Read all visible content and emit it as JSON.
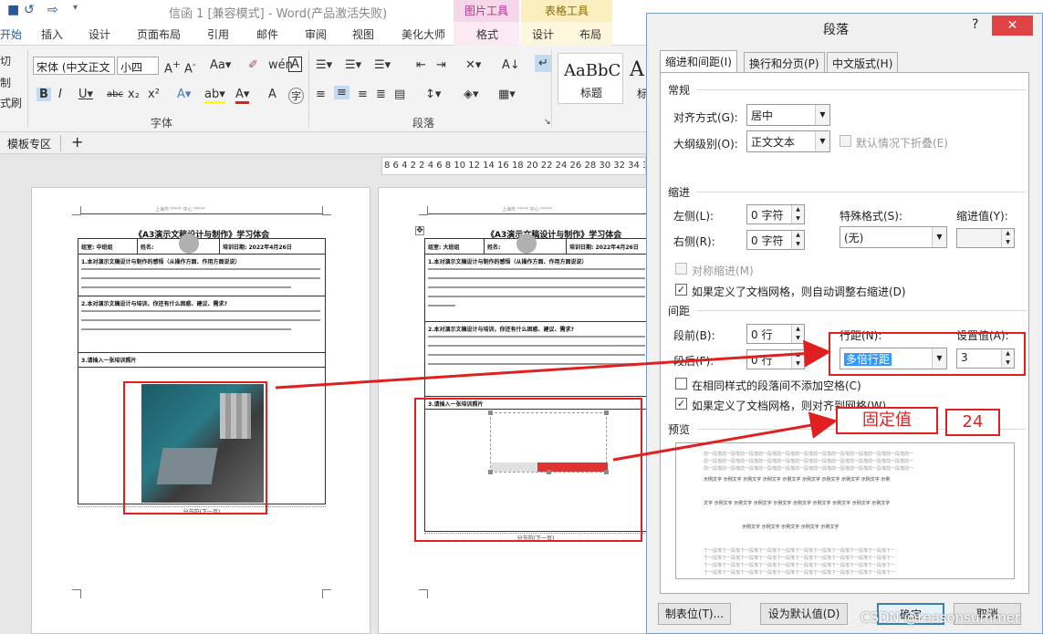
{
  "window": {
    "title": "信函 1 [兼容模式] - Word(产品激活失败)",
    "context_tab_picture": "图片工具",
    "context_tab_table": "表格工具"
  },
  "ribbon_tabs": [
    "开始",
    "插入",
    "设计",
    "页面布局",
    "引用",
    "邮件",
    "审阅",
    "视图",
    "美化大师",
    "格式",
    "设计",
    "布局"
  ],
  "ribbon": {
    "clipboard_cut": "切",
    "clipboard_copy": "制",
    "clipboard_format": "式刷",
    "font_name": "宋体 (中文正文",
    "font_size": "小四",
    "font_group_label": "字体",
    "paragraph_group_label": "段落",
    "style_preview": "AaBbC",
    "style_name": "标题",
    "style_preview2": "A",
    "style_name2": "标"
  },
  "template_bar": {
    "label": "模板专区",
    "add": "+"
  },
  "ruler_text": "8 6 4 2 2 4 6 8 10 12 14 16 18 20 22 24 26 28 30 32 34 36 38",
  "page_left": {
    "header": "上海市 ***** 中心 *****",
    "title": "《A3演示文稿设计与制作》学习体会",
    "unit": "组室: 中班组",
    "name": "姓名:",
    "date": "培训日期: 2022年4月26日",
    "q1": "1.本对演示文稿设计与制作的感悟（从操作方面、作用方面说说）",
    "q2": "2.本对演示文稿设计与培训，你还有什么困惑、建议、需求?",
    "q3": "3.请插入一张培训照片",
    "section_break": "分节符(下一页)"
  },
  "page_right": {
    "header": "上海市 ***** 中心 *****",
    "title": "《A3演示文稿设计与制作》学习体会",
    "unit": "组室: 大班组",
    "name": "姓名:",
    "date": "培训日期: 2022年4月26日",
    "q1": "1.本对演示文稿设计与制作的感悟（从操作方面、作用方面说说）",
    "q2": "2.本对演示文稿设计与培训，你还有什么困惑、建议、需求?",
    "q3": "3.请插入一张培训照片",
    "section_break": "分节符(下一页)"
  },
  "dialog": {
    "title": "段落",
    "help": "?",
    "close": "✕",
    "tabs": [
      "缩进和间距(I)",
      "换行和分页(P)",
      "中文版式(H)"
    ],
    "active_tab": 0,
    "general": {
      "section": "常规",
      "alignment_label": "对齐方式(G):",
      "alignment_value": "居中",
      "outline_label": "大纲级别(O):",
      "outline_value": "正文文本",
      "collapse_label": "默认情况下折叠(E)"
    },
    "indent": {
      "section": "缩进",
      "left_label": "左侧(L):",
      "left_value": "0 字符",
      "right_label": "右侧(R):",
      "right_value": "0 字符",
      "special_label": "特殊格式(S):",
      "special_value": "(无)",
      "by_label": "缩进值(Y):",
      "by_value": "",
      "mirror_label": "对称缩进(M)",
      "auto_adjust_label": "如果定义了文档网格，则自动调整右缩进(D)",
      "auto_adjust_checked": true
    },
    "spacing": {
      "section": "间距",
      "before_label": "段前(B):",
      "before_value": "0 行",
      "after_label": "段后(F):",
      "after_value": "0 行",
      "line_spacing_label": "行距(N):",
      "line_spacing_value": "多倍行距",
      "at_label": "设置值(A):",
      "at_value": "3",
      "no_space_label": "在相同样式的段落间不添加空格(C)",
      "no_space_checked": false,
      "snap_grid_label": "如果定义了文档网格，则对齐到网格(W)",
      "snap_grid_checked": true
    },
    "preview": {
      "section": "预览",
      "prev_para": "前一段落前一段落前一段落前一段落前一段落前一段落前一段落前一段落前一段落前一段落前一段落前一",
      "sample1": "示例文字 示例文字 示例文字 示例文字 示例文字 示例文字 示例文字 示例文字 示例文字 示例",
      "sample2": "文字 示例文字 示例文字 示例文字 示例文字 示例文字 示例文字 示例文字 示例文字 示例文字",
      "sample3": "示例文字 示例文字 示例文字 示例文字 示例文字",
      "next_para": "下一段落下一段落下一段落下一段落下一段落下一段落下一段落下一段落下一段落下一段落下一"
    },
    "buttons": {
      "tabs": "制表位(T)...",
      "set_default": "设为默认值(D)",
      "ok": "确定",
      "cancel": "取消"
    }
  },
  "annotations": {
    "fixed_value": "固定值",
    "value_24": "24"
  },
  "watermark": "CSDN @reasonsummer",
  "colors": {
    "accent": "#2b579a",
    "annotation_red": "#e02020",
    "close_button": "#e04343",
    "selected_dropdown": "#3399ff"
  }
}
